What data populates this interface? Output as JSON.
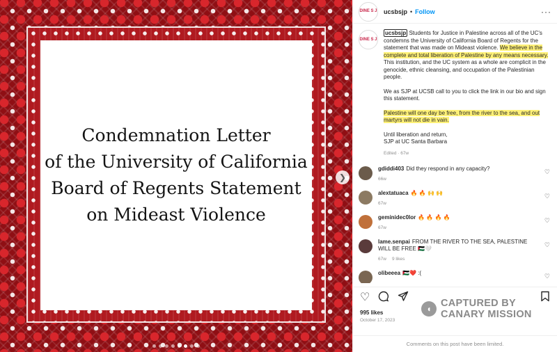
{
  "post": {
    "image_text_lines": [
      "Condemnation Letter",
      "of the University of California",
      "Board of Regents Statement",
      "on Mideast Violence"
    ],
    "slide_count": 8,
    "active_slide": 5
  },
  "header": {
    "avatar_text": "DINE S J",
    "username": "ucsbsjp",
    "separator": "•",
    "follow_label": "Follow",
    "more_label": "···"
  },
  "caption": {
    "username": "ucsbsjp",
    "p1_before": " Students for Justice in Palestine across all of the UC's condemns the University of California Board of Regents for the statement that was made on Mideast violence. ",
    "p1_highlight": "We believe in the complete and total liberation of Palestine by any means necessary.",
    "p1_after": " This institution, and the UC system as a whole are complicit in the genocide, ethnic cleansing, and occupation of the Palestinian people.",
    "p2": "We as SJP at UCSB call to you to click the link in our bio and sign this statement.",
    "p3_highlight": "Palestine will one day be free, from the river to the sea, and out martyrs will not die in vain.",
    "p4_line1": "Until liberation and return,",
    "p4_line2": "SJP at UC Santa Barbara",
    "edited": "Edited · 67w"
  },
  "comments": [
    {
      "username": "gdiddi403",
      "text": "Did they respond in any capacity?",
      "time": "66w",
      "likes": "",
      "avatar_color": "#6b5b4b"
    },
    {
      "username": "alextatuaca",
      "text": "🔥 🔥 🙌 🙌",
      "time": "67w",
      "likes": "",
      "avatar_color": "#8c7a62"
    },
    {
      "username": "geminidec0lor",
      "text": "🔥 🔥 🔥 🔥",
      "time": "67w",
      "likes": "",
      "avatar_color": "#c0703a"
    },
    {
      "username": "lame.senpai",
      "text": "FROM THE RIVER TO THE SEA, PALESTINE WILL BE FREE 🇵🇸🤍",
      "time": "67w",
      "likes": "9 likes",
      "avatar_color": "#5a3b3b"
    },
    {
      "username": "olibeeea",
      "text": "🇵🇸❤️ :(",
      "time": "",
      "likes": "",
      "avatar_color": "#7a6652"
    }
  ],
  "actions": {
    "like_icon": "heart-icon",
    "comment_icon": "comment-icon",
    "share_icon": "share-icon",
    "save_icon": "bookmark-icon"
  },
  "likes_label": "995 likes",
  "date_label": "October 17, 2023",
  "footer_label": "Comments on this post have been limited.",
  "watermark": {
    "line1": "CAPTURED BY",
    "line2": "CANARY MISSION"
  }
}
